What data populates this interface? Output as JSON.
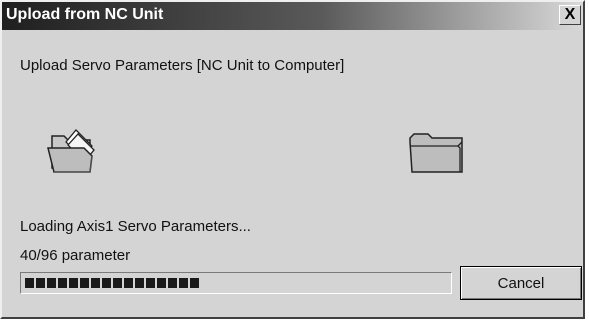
{
  "window": {
    "title": "Upload from NC Unit",
    "close_glyph": "X",
    "description": "Upload Servo Parameters [NC Unit to Computer]"
  },
  "icons": {
    "source": "open-folder-icon",
    "destination": "closed-folder-icon"
  },
  "progress": {
    "status": "Loading Axis1 Servo Parameters...",
    "count_text": "40/96 parameter",
    "current": 40,
    "total": 96
  },
  "buttons": {
    "cancel_label": "Cancel"
  },
  "colors": {
    "face": "#d4d4d4",
    "progress_fill": "#1a1a1a"
  }
}
